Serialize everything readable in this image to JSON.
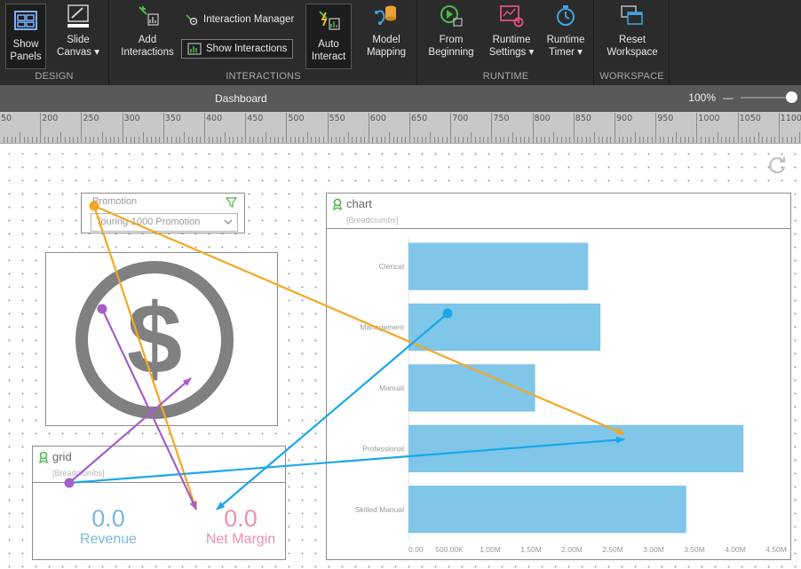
{
  "ribbon": {
    "groups": {
      "design": "DESIGN",
      "interactions": "INTERACTIONS",
      "runtime": "RUNTIME",
      "workspace": "WORKSPACE"
    },
    "buttons": {
      "show_panels": [
        "Show",
        "Panels"
      ],
      "slide_canvas": [
        "Slide",
        "Canvas ▾"
      ],
      "add_interactions": [
        "Add",
        "Interactions"
      ],
      "interaction_manager": "Interaction Manager",
      "show_interactions": "Show Interactions",
      "auto_interact": [
        "Auto",
        "Interact"
      ],
      "model_mapping": [
        "Model",
        "Mapping"
      ],
      "from_beginning": [
        "From",
        "Beginning"
      ],
      "runtime_settings": [
        "Runtime",
        "Settings ▾"
      ],
      "runtime_timer": [
        "Runtime",
        "Timer ▾"
      ],
      "reset_workspace": [
        "Reset",
        "Workspace"
      ]
    }
  },
  "dashboard": {
    "title": "Dashboard",
    "zoom": "100%",
    "zoom_minus": "—"
  },
  "ruler": {
    "labels": [
      "50",
      "200",
      "250",
      "300",
      "350",
      "400",
      "450",
      "500",
      "550",
      "600",
      "650",
      "700",
      "750",
      "800",
      "850",
      "900",
      "950",
      "1000",
      "1050",
      "1100"
    ]
  },
  "widgets": {
    "promotion": {
      "title": "Promotion",
      "selected": "Touring-1000 Promotion"
    },
    "chart": {
      "title": "chart",
      "breadcrumbs": "[Breadcrumbs]"
    },
    "grid": {
      "title": "grid",
      "breadcrumbs": "[Breadcrumbs]",
      "revenue_value": "0.0",
      "revenue_label": "Revenue",
      "margin_value": "0.0",
      "margin_label": "Net Margin"
    }
  },
  "colors": {
    "bar": "#7fc6e8",
    "revenue": "#7cb8dd",
    "net_margin": "#ee8fb0",
    "arrow_orange": "#f5a623",
    "arrow_blue": "#1aa7ec",
    "arrow_purple": "#a45fc8"
  },
  "chart_data": {
    "type": "bar",
    "orientation": "horizontal",
    "categories": [
      "Clerical",
      "Management",
      "Manual",
      "Professional",
      "Skilled Manual"
    ],
    "values": [
      2.2,
      2.35,
      1.55,
      4.1,
      3.4
    ],
    "x_ticks": [
      "0.00",
      "500.00K",
      "1.00M",
      "1.50M",
      "2.00M",
      "2.50M",
      "3.00M",
      "3.50M",
      "4.00M",
      "4.50M"
    ],
    "xlim": [
      0,
      4.5
    ],
    "grid": false,
    "legend": "none"
  }
}
